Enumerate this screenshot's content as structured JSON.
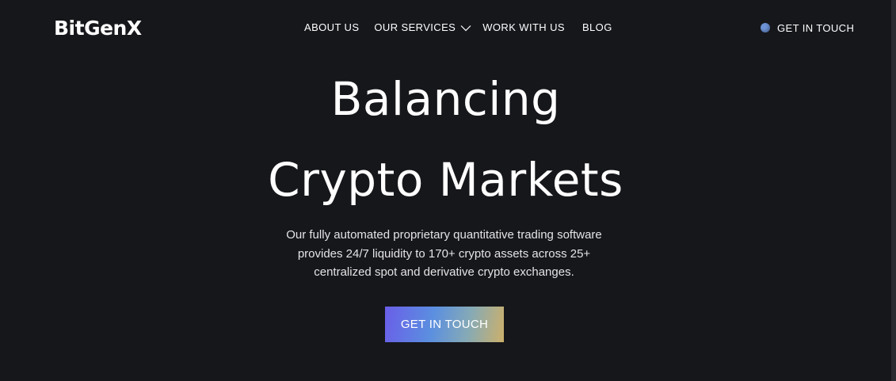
{
  "header": {
    "logo": "BitGenX",
    "nav": {
      "about": "ABOUT US",
      "services": "OUR SERVICES",
      "work": "WORK WITH US",
      "blog": "BLOG"
    },
    "cta_label": "GET IN TOUCH",
    "dot_color": "#6d93d6"
  },
  "hero": {
    "title_line1": "Balancing",
    "title_line2": "Crypto Markets",
    "subtitle_lines": [
      "Our fully automated proprietary quantitative trading software",
      "provides 24/7 liquidity to 170+ crypto assets across 25+",
      "centralized spot and derivative crypto exchanges."
    ],
    "cta_label": "GET IN TOUCH"
  },
  "colors": {
    "background": "#16171b",
    "text": "#ffffff",
    "cta_gradient": [
      "#6a5ee8",
      "#5b8fe0",
      "#86aab5",
      "#cdb06a"
    ]
  }
}
